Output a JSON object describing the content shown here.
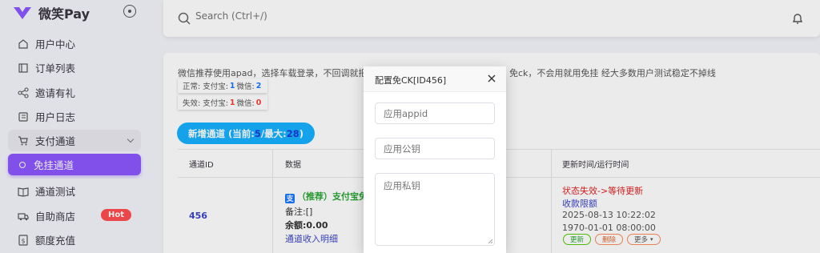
{
  "brand": {
    "name": "微笑Pay"
  },
  "sidebar": {
    "items": [
      {
        "label": "用户中心",
        "icon": "home-icon"
      },
      {
        "label": "订单列表",
        "icon": "list-icon"
      },
      {
        "label": "邀请有礼",
        "icon": "share-icon"
      },
      {
        "label": "用户日志",
        "icon": "log-icon"
      },
      {
        "label": "支付通道",
        "icon": "cart-icon"
      },
      {
        "label": "免挂通道",
        "icon": "circle-icon"
      },
      {
        "label": "通道测试",
        "icon": "book-icon"
      },
      {
        "label": "自助商店",
        "icon": "truck-icon",
        "badge": "Hot"
      },
      {
        "label": "额度充值",
        "icon": "dollar-icon"
      }
    ]
  },
  "search": {
    "placeholder": "Search (Ctrl+/)"
  },
  "notice": {
    "left": "微信推荐使用apad，选择车载登录，不回调就把",
    "right": "免ck，不会用就用免挂 经大多数用户测试稳定不掉线"
  },
  "stats": {
    "normal_prefix": "正常: 支付宝:",
    "normal_alipay": "1",
    "normal_mid": "微信:",
    "normal_wechat": "2",
    "fail_prefix": "失效: 支付宝:",
    "fail_alipay": "1",
    "fail_mid": "微信:",
    "fail_wechat": "0"
  },
  "add_button": {
    "prefix": "新增通道 (当前:",
    "current": "5",
    "mid": "/最大:",
    "max": "28",
    "suffix": ")"
  },
  "table": {
    "headers": [
      "通道ID",
      "数据",
      "更新时间/运行时间"
    ],
    "row": {
      "id": "456",
      "channel": "（推荐）支付宝免",
      "remark": "备注:[]",
      "balance": "余额:0.00",
      "detail_link": "通道收入明细",
      "status": "状态失效->等待更新",
      "limit": "收款限额",
      "updated": "2025-08-13 10:22:02",
      "runtime": "1970-01-01 08:00:00",
      "btn_update": "更新",
      "btn_delete": "删除",
      "btn_more": "更多"
    }
  },
  "modal": {
    "title": "配置免CK[ID456]",
    "appid_placeholder": "应用appid",
    "pubkey_placeholder": "应用公钥",
    "privkey_placeholder": "应用私钥"
  },
  "colors": {
    "accent": "#8c57ff",
    "info": "#16b1ff",
    "danger": "#ff4c51"
  }
}
